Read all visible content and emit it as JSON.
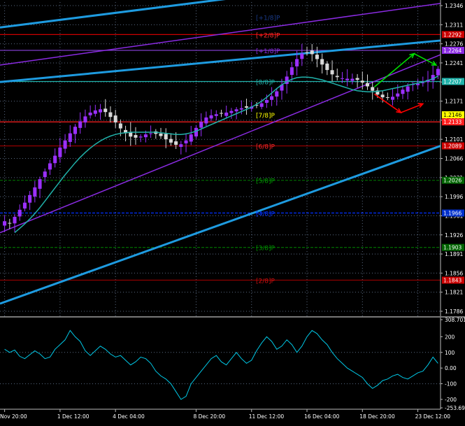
{
  "colors": {
    "background": "#000000",
    "bull": "#9b30ff",
    "bear": "#d8d8d8",
    "ma": "#20b2aa",
    "channel_main": "#1e9be0",
    "channel_inner": "#8a2be2",
    "grid": "#5a6a82",
    "axis_text": "#ffffff",
    "cci": "#00c8e6",
    "up_arrow": "#00e000",
    "down_arrow": "#ff0000",
    "separator": "#777777"
  },
  "chart_data": [
    {
      "type": "candlestick",
      "instrument": "EURUSD",
      "timeframe": "4h",
      "ylim": [
        1.1786,
        1.2346
      ],
      "y_ticks": [
        1.2346,
        1.2311,
        1.2276,
        1.2241,
        1.2206,
        1.2171,
        1.2136,
        1.2101,
        1.2066,
        1.2031,
        1.1996,
        1.1961,
        1.1926,
        1.1891,
        1.1856,
        1.1821,
        1.1786
      ],
      "x_ticks": [
        "Nov 20:00",
        "1 Dec 12:00",
        "4 Dec 04:00",
        "8 Dec 20:00",
        "11 Dec 12:00",
        "16 Dec 04:00",
        "18 Dec 20:00",
        "23 Dec 12:00"
      ],
      "x_tick_bar_index": [
        0,
        11,
        22,
        38,
        49,
        60,
        71,
        82
      ],
      "closes": [
        1.1951,
        1.1947,
        1.1959,
        1.1972,
        1.1985,
        1.1999,
        1.2013,
        1.2028,
        1.2042,
        1.2057,
        1.2071,
        1.2086,
        1.2099,
        1.2112,
        1.2124,
        1.2134,
        1.2143,
        1.215,
        1.2154,
        1.2156,
        1.2151,
        1.2142,
        1.2132,
        1.2121,
        1.2112,
        1.2106,
        1.2104,
        1.2106,
        1.211,
        1.2112,
        1.2111,
        1.2107,
        1.2101,
        1.2095,
        1.2091,
        1.2092,
        1.2099,
        1.211,
        1.2122,
        1.2133,
        1.2141,
        1.2145,
        1.2147,
        1.2148,
        1.215,
        1.2153,
        1.2156,
        1.2158,
        1.2159,
        1.2161,
        1.2163,
        1.2167,
        1.2173,
        1.218,
        1.2189,
        1.2201,
        1.2216,
        1.2233,
        1.2248,
        1.2258,
        1.226,
        1.2257,
        1.2248,
        1.2238,
        1.2228,
        1.222,
        1.2215,
        1.2213,
        1.2212,
        1.2212,
        1.221,
        1.2205,
        1.2198,
        1.219,
        1.2183,
        1.2178,
        1.2177,
        1.2179,
        1.2185,
        1.2192,
        1.2198,
        1.2202,
        1.2203,
        1.2205,
        1.221,
        1.2219,
        1.223
      ],
      "ma_series": {
        "start_index": 2,
        "values": [
          1.193,
          1.1938,
          1.1946,
          1.1955,
          1.1965,
          1.1976,
          1.1988,
          1.2,
          1.2012,
          1.2024,
          1.2036,
          1.2047,
          1.2058,
          1.2068,
          1.2077,
          1.2085,
          1.2092,
          1.2098,
          1.2103,
          1.2107,
          1.211,
          1.2112,
          1.2113,
          1.2114,
          1.2114,
          1.2114,
          1.2114,
          1.2114,
          1.2114,
          1.2113,
          1.2112,
          1.2111,
          1.211,
          1.211,
          1.2111,
          1.2113,
          1.2116,
          1.212,
          1.2124,
          1.2128,
          1.2132,
          1.2136,
          1.214,
          1.2144,
          1.2148,
          1.2152,
          1.2156,
          1.216,
          1.2165,
          1.2171,
          1.2178,
          1.2186,
          1.2194,
          1.2201,
          1.2207,
          1.2211,
          1.2214,
          1.2215,
          1.2215,
          1.2214,
          1.2212,
          1.221,
          1.2207,
          1.2204,
          1.2201,
          1.2198,
          1.2195,
          1.2192,
          1.219,
          1.2189,
          1.2188,
          1.2188,
          1.2189,
          1.219,
          1.2192,
          1.2194,
          1.2196,
          1.2198,
          1.22,
          1.2202,
          1.2204,
          1.2206,
          1.2209,
          1.2212,
          1.2217
        ]
      },
      "murrey_levels": [
        {
          "label": "[+1/8]P",
          "price": 1.2325,
          "color": "#1a3b8a",
          "line": false
        },
        {
          "label": "[+2/8]P",
          "price": 1.2293,
          "color": "#ff3030",
          "line": true,
          "line_color": "#cc0000"
        },
        {
          "label": "[+1/8]P",
          "price": 1.2264,
          "color": "#8a2be2",
          "line": true,
          "line_color": "#7d3cc8"
        },
        {
          "label": "[8/8]P",
          "price": 1.2207,
          "color": "#20b2aa",
          "line": true,
          "line_color": "#20b2aa"
        },
        {
          "label": "[7/8]P",
          "price": 1.2146,
          "color": "#ffff00",
          "line": false
        },
        {
          "label": "",
          "price": 1.2133,
          "color": "#ff2020",
          "line": true,
          "line_color": "#ff2020"
        },
        {
          "label": "[6/8]P",
          "price": 1.2089,
          "color": "#ff2a2a",
          "line": true,
          "line_color": "#8b0000"
        },
        {
          "label": "[5/8]P",
          "price": 1.2026,
          "color": "#00a000",
          "line": true,
          "line_color": "#006400",
          "dashed": true
        },
        {
          "label": "[4/8]P",
          "price": 1.1966,
          "color": "#0030ff",
          "line": true,
          "line_color": "#0030ff",
          "dashed": true
        },
        {
          "label": "[3/8]P",
          "price": 1.1903,
          "color": "#009000",
          "line": true,
          "line_color": "#006400",
          "dashed": true
        },
        {
          "label": "[2/8]P",
          "price": 1.1843,
          "color": "#cc1010",
          "line": true,
          "line_color": "#8b0000"
        }
      ],
      "price_boxes": [
        {
          "value": "1.2292",
          "price": 1.2293,
          "bg": "#cc0000",
          "fg": "#ffffff"
        },
        {
          "value": "1.2264",
          "price": 1.2264,
          "bg": "#8a2be2",
          "fg": "#ffffff"
        },
        {
          "value": "1.2207",
          "price": 1.2207,
          "bg": "#20b2aa",
          "fg": "#ffffff"
        },
        {
          "value": "1.2146",
          "price": 1.2146,
          "bg": "#ffff00",
          "fg": "#000000"
        },
        {
          "value": "1.2133",
          "price": 1.2133,
          "bg": "#ff2020",
          "fg": "#ffffff"
        },
        {
          "value": "1.2089",
          "price": 1.2089,
          "bg": "#cc0000",
          "fg": "#ffffff"
        },
        {
          "value": "1.2026",
          "price": 1.2026,
          "bg": "#006400",
          "fg": "#ffffff"
        },
        {
          "value": "1.1966",
          "price": 1.1966,
          "bg": "#0030cc",
          "fg": "#ffffff"
        },
        {
          "value": "1.1903",
          "price": 1.1903,
          "bg": "#006400",
          "fg": "#ffffff"
        },
        {
          "value": "1.1843",
          "price": 1.1843,
          "bg": "#cc0000",
          "fg": "#ffffff"
        }
      ],
      "channel_lines": [
        {
          "kind": "main",
          "from": [
            0,
            1.2206
          ],
          "to": [
            100,
            1.2282
          ]
        },
        {
          "kind": "main",
          "from": [
            0,
            1.18
          ],
          "to": [
            100,
            1.2089
          ]
        },
        {
          "kind": "main",
          "from": [
            0,
            1.2306
          ],
          "to": [
            55,
            1.2362
          ]
        },
        {
          "kind": "inner",
          "from": [
            0,
            1.2237
          ],
          "to": [
            100,
            1.235
          ]
        },
        {
          "kind": "inner",
          "from": [
            0,
            1.193
          ],
          "to": [
            100,
            1.2256
          ]
        }
      ],
      "forecast_arrows": [
        {
          "color": "up",
          "points": [
            [
              85,
              1.2197
            ],
            [
              94,
              1.2258
            ],
            [
              99,
              1.2237
            ]
          ]
        },
        {
          "color": "down",
          "points": [
            [
              85,
              1.2184
            ],
            [
              91,
              1.215
            ],
            [
              96,
              1.2166
            ]
          ]
        }
      ]
    },
    {
      "type": "line",
      "indicator": "CCI",
      "ylim": [
        -253.695,
        308.7018
      ],
      "y_ticks": [
        "308.7018",
        "200",
        "100",
        "0.00",
        "-100",
        "-200",
        "-253.695"
      ],
      "y_tick_values": [
        308.7018,
        200,
        100,
        0,
        -100,
        -200,
        -253.695
      ],
      "values": [
        120,
        100,
        115,
        75,
        60,
        85,
        110,
        90,
        60,
        70,
        120,
        150,
        180,
        240,
        200,
        170,
        110,
        80,
        110,
        140,
        120,
        90,
        70,
        80,
        50,
        20,
        40,
        70,
        60,
        30,
        -20,
        -50,
        -70,
        -100,
        -150,
        -200,
        -180,
        -100,
        -60,
        -20,
        20,
        60,
        80,
        40,
        20,
        60,
        100,
        60,
        30,
        50,
        110,
        160,
        200,
        170,
        120,
        140,
        180,
        150,
        100,
        140,
        200,
        240,
        220,
        180,
        150,
        100,
        60,
        30,
        0,
        -20,
        -40,
        -60,
        -100,
        -130,
        -110,
        -80,
        -70,
        -50,
        -40,
        -60,
        -70,
        -50,
        -30,
        -20,
        20,
        70,
        30
      ]
    }
  ]
}
